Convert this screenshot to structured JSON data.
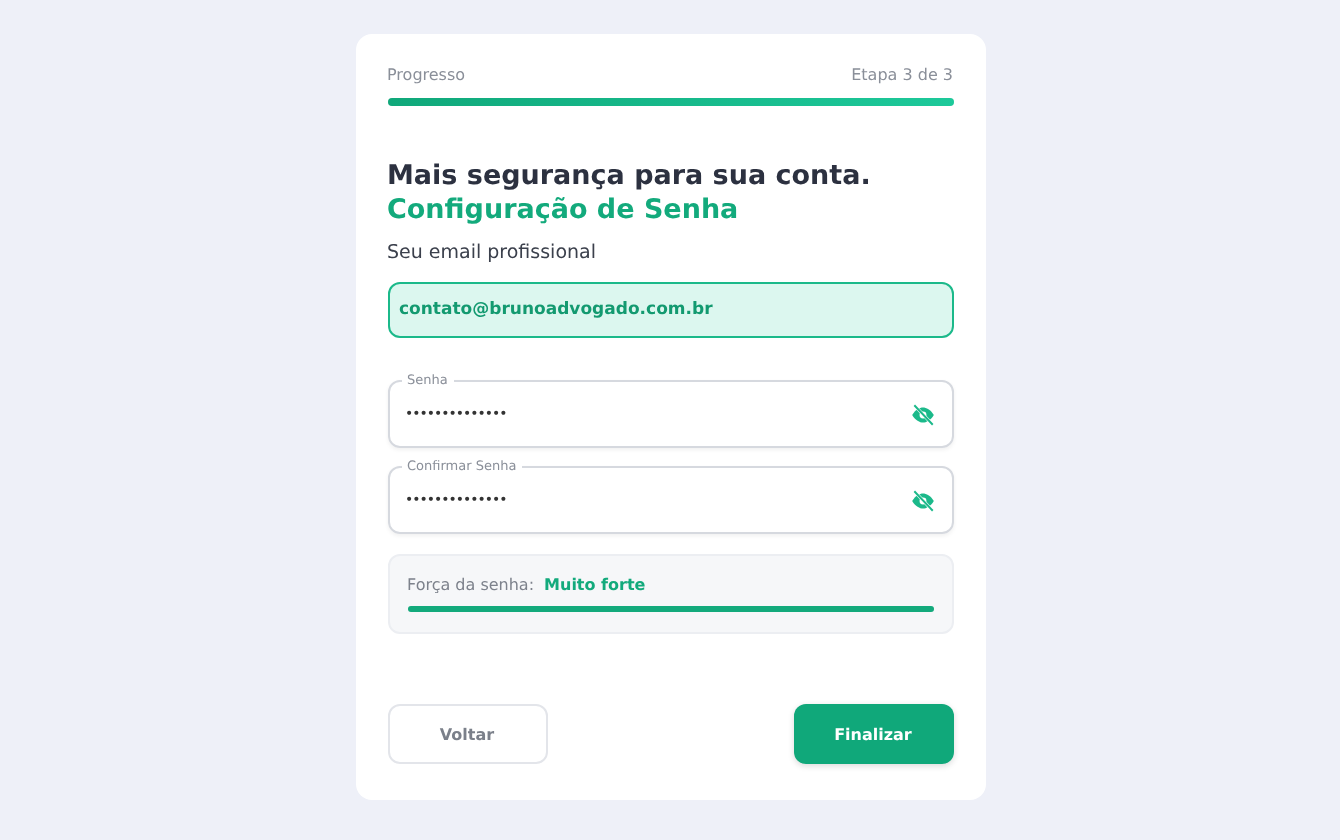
{
  "progress": {
    "label": "Progresso",
    "step": "Etapa 3 de 3",
    "level": 1
  },
  "heading": {
    "title": "Mais segurança para sua conta.",
    "subtitle": "Configuração de Senha"
  },
  "email": {
    "label": "Seu email profissional",
    "value": "contato@brunoadvogado.com.br"
  },
  "password_fields": [
    {
      "label": "Senha",
      "value": "••••••••••••••"
    },
    {
      "label": "Confirmar Senha",
      "value": "••••••••••••••"
    }
  ],
  "strength": {
    "label": "Força da senha:",
    "value": "Muito forte",
    "level": 1
  },
  "buttons": [
    {
      "label": "Voltar",
      "kind": "secondary"
    },
    {
      "label": "Finalizar",
      "kind": "primary"
    }
  ]
}
